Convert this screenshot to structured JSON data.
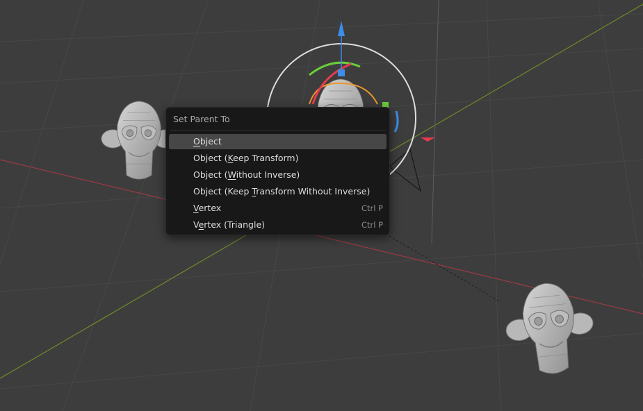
{
  "viewport": {
    "background": "#3d3d3d",
    "axis_colors": {
      "x": "#9c3a44",
      "y": "#6e8a2a",
      "z": "#5d5d5d"
    },
    "gizmo_colors": {
      "x": "#e63b4f",
      "y": "#6bcc3a",
      "z": "#3c8dea",
      "view": "#dddddd",
      "selected_outline": "#e8952b"
    },
    "objects": [
      "suzanne-monkey-left",
      "suzanne-monkey-center-selected",
      "suzanne-monkey-right"
    ]
  },
  "menu": {
    "title": "Set Parent To",
    "items": [
      {
        "pre": "",
        "u": "O",
        "post": "bject",
        "shortcut": "",
        "active": true
      },
      {
        "pre": "Object (",
        "u": "K",
        "post": "eep Transform)",
        "shortcut": ""
      },
      {
        "pre": "Object (",
        "u": "W",
        "post": "ithout Inverse)",
        "shortcut": ""
      },
      {
        "pre": "Object (Keep ",
        "u": "T",
        "post": "ransform Without Inverse)",
        "shortcut": ""
      },
      {
        "pre": "",
        "u": "V",
        "post": "ertex",
        "shortcut": "Ctrl P"
      },
      {
        "pre": "V",
        "u": "e",
        "post": "rtex (Triangle)",
        "shortcut": "Ctrl P"
      }
    ]
  }
}
